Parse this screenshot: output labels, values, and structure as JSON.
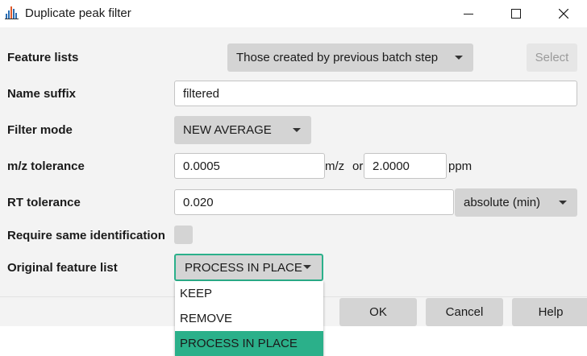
{
  "window": {
    "title": "Duplicate peak filter",
    "icon": "chart-app-icon",
    "controls": [
      "minimize-icon",
      "maximize-icon",
      "close-icon"
    ]
  },
  "form": {
    "feature_lists": {
      "label": "Feature lists",
      "value": "Those created by previous batch step",
      "select_label": "Select"
    },
    "name_suffix": {
      "label": "Name suffix",
      "value": "filtered"
    },
    "filter_mode": {
      "label": "Filter mode",
      "value": "NEW AVERAGE"
    },
    "mz_tolerance": {
      "label": "m/z tolerance",
      "mz_value": "0.0005",
      "mz_unit": "m/z",
      "or_text": "or",
      "ppm_value": "2.0000",
      "ppm_unit": "ppm"
    },
    "rt_tolerance": {
      "label": "RT tolerance",
      "value": "0.020",
      "unit_value": "absolute (min)"
    },
    "require_same_id": {
      "label": "Require same identification",
      "checked": false
    },
    "original_feature_list": {
      "label": "Original feature list",
      "value": "PROCESS IN PLACE"
    }
  },
  "buttons": {
    "ok": "OK",
    "cancel": "Cancel",
    "help": "Help"
  },
  "dropdown": {
    "options": [
      "KEEP",
      "REMOVE",
      "PROCESS IN PLACE"
    ],
    "selected": "PROCESS IN PLACE"
  },
  "colors": {
    "accent": "#2bb08a",
    "control_bg": "#d4d4d4",
    "window_bg": "#f3f3f3"
  }
}
